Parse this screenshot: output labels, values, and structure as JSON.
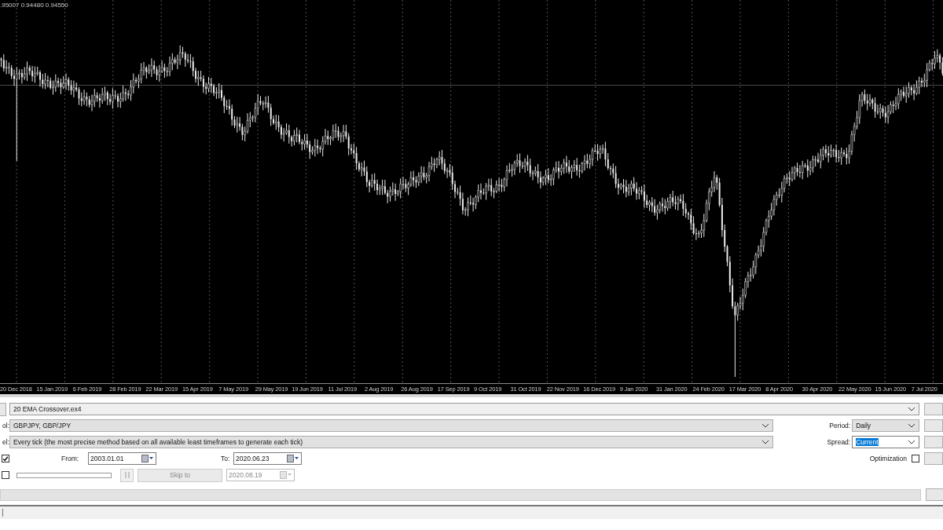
{
  "chart": {
    "ohlc_readout": ".95007 0.94480 0.94550",
    "date_labels": [
      "20 Dec 2018",
      "15 Jan 2019",
      "6 Feb 2019",
      "28 Feb 2019",
      "22 Mar 2019",
      "15 Apr 2019",
      "7 May 2019",
      "29 May 2019",
      "19 Jun 2019",
      "11 Jul 2019",
      "2 Aug 2019",
      "26 Aug 2019",
      "17 Sep 2019",
      "9 Oct 2019",
      "31 Oct 2019",
      "22 Nov 2019",
      "16 Dec 2019",
      "9 Jan 2020",
      "31 Jan 2020",
      "24 Feb 2020",
      "17 Mar 2020",
      "8 Apr 2020",
      "30 Apr 2020",
      "22 May 2020",
      "15 Jun 2020",
      "7 Jul 2020"
    ]
  },
  "tester": {
    "expert": {
      "value": "20 EMA Crossover.ex4"
    },
    "symbol": {
      "label": "ol:",
      "value": "GBPJPY, GBP/JPY"
    },
    "period": {
      "label": "Period:",
      "value": "Daily"
    },
    "model": {
      "label": "el:",
      "value": "Every tick (the most precise method based on all available least timeframes to generate each tick)"
    },
    "spread": {
      "label": "Spread:",
      "value": "Current",
      "selected": true
    },
    "use_date": {
      "checked": true
    },
    "from": {
      "label": "From:",
      "value": "2003.01.01"
    },
    "to": {
      "label": "To:",
      "value": "2020.06.23"
    },
    "optimization": {
      "label": "Optimization",
      "checked": false
    },
    "visual_mode": {
      "checked": false
    },
    "progress": {
      "level": 0
    },
    "skip_to": {
      "label": "Skip to",
      "disabled": true
    },
    "skip_date": {
      "value": "2020.08.19",
      "disabled": true
    }
  }
}
